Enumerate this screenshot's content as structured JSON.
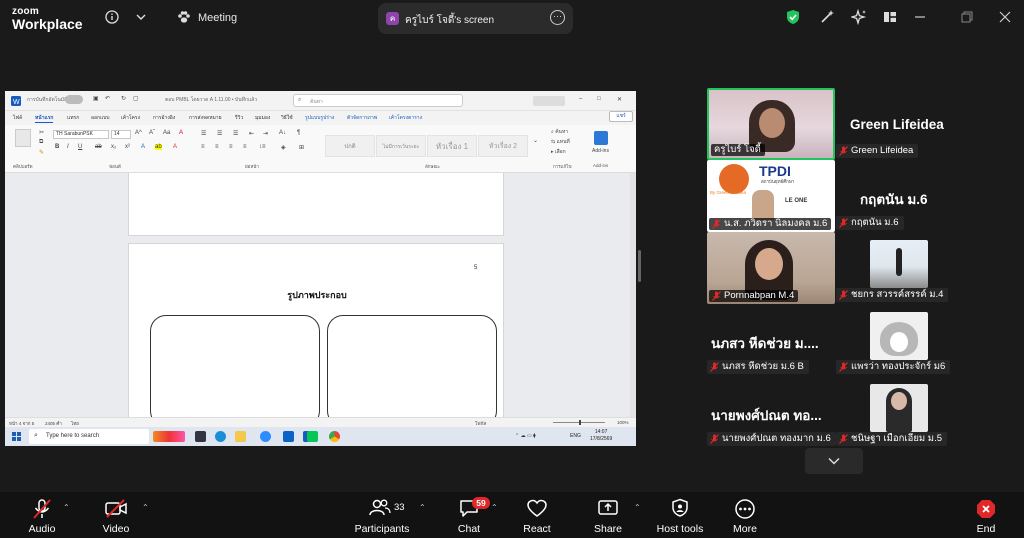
{
  "app": {
    "brand_top": "zoom",
    "brand_bottom": "Workplace",
    "meeting_label": "Meeting"
  },
  "share_tab": {
    "avatar_letter": "ค",
    "title": "ครูไบร์ โจดี้'s screen"
  },
  "word": {
    "title_text": "ตอบ PMBL โดยวาด A 1.11.00 • บันทึกแล้ว",
    "autosave": "การบันทึกอัตโนมัติ",
    "search_placeholder": "ค้นหา",
    "tabs": [
      "ไฟล์",
      "หน้าแรก",
      "แทรก",
      "ออกแบบ",
      "เค้าโครง",
      "การอ้างอิง",
      "การส่งจดหมาย",
      "รีวิว",
      "มุมมอง",
      "วิธีใช้",
      "รูปแบบรูปร่าง",
      "ตัวจัดการภาพ",
      "เค้าโครงตาราง"
    ],
    "share_button": "แชร์",
    "font_name": "TH SarabunPSK",
    "font_size": "14",
    "styles": [
      "ปกติ",
      "ไม่มีการเว้นระยะ",
      "หัวเรื่อง 1",
      "หัวเรื่อง 2"
    ],
    "groups": [
      "คลิปบอร์ด",
      "ฟอนต์",
      "ย่อหน้า",
      "ลักษณะ",
      "การแก้ไข",
      "Add-ins"
    ],
    "addins_label": "Add-ins",
    "page_number": "5",
    "page_title": "รูปภาพประกอบ",
    "status_left": "หน้า 4 จาก 5",
    "status_words": "2405 คำ",
    "status_lang": "ไทย",
    "status_focus": "โฟกัส",
    "zoom_level": "100%"
  },
  "taskbar": {
    "search_text": "Type here to search",
    "lang": "ENG",
    "time": "14:07",
    "date": "17/8/2569"
  },
  "participants": [
    {
      "name": "ครูไบร์ โจดี้",
      "kind": "video",
      "active": true
    },
    {
      "name": "น.ส. ภวิดรา นิลมงคล ม.6",
      "kind": "video"
    },
    {
      "name": "Pornnabpan M.4",
      "kind": "video"
    },
    {
      "name": "Green Lifeidea",
      "kind": "name",
      "display": "Green Lifeidea"
    },
    {
      "name": "กฤตนัน ม.6",
      "kind": "name",
      "display": "กฤตนัน ม.6"
    },
    {
      "name": "ชยกร สวรรค์สรรค์ ม.4",
      "kind": "photo"
    },
    {
      "name": "นภสร หีดช่วย ม.6 B",
      "kind": "name",
      "display": "นภสว หีดช่วย ม...."
    },
    {
      "name": "แพรว่า ทองประจักร์ ม6",
      "kind": "photo"
    },
    {
      "name": "นายพงศ์ปณต ทองมาก ม.6",
      "kind": "name",
      "display": "นายพงศ์ปณต ทอ..."
    },
    {
      "name": "ชนิษฐา เมือกเอียม ม.5",
      "kind": "photo"
    }
  ],
  "video_overlays": {
    "tpdi_big": "TPDI",
    "tpdi_small": "สถาบันยุทธ์ศึกษา",
    "tpdi_line": "By Green Lifeidea",
    "tpdi_tag": "LE ONE"
  },
  "toolbar": {
    "audio": "Audio",
    "video": "Video",
    "participants": "Participants",
    "participants_count": "33",
    "chat": "Chat",
    "chat_badge": "59",
    "react": "React",
    "share": "Share",
    "host_tools": "Host tools",
    "more": "More",
    "end": "End"
  },
  "colors": {
    "accent_green": "#23c45e",
    "end_red": "#e02828",
    "word_blue": "#185abd"
  }
}
